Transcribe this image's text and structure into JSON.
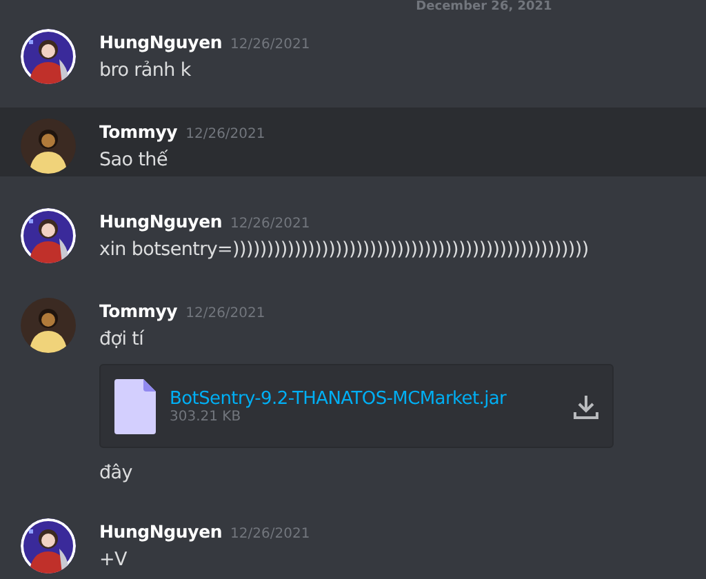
{
  "date_divider": "December 26, 2021",
  "messages": [
    {
      "author": "HungNguyen",
      "timestamp": "12/26/2021",
      "avatar": {
        "kind": "red"
      },
      "highlighted": false,
      "content": [
        {
          "kind": "text",
          "text": "bro rảnh k"
        }
      ]
    },
    {
      "author": "Tommyy",
      "timestamp": "12/26/2021",
      "avatar": {
        "kind": "yellow"
      },
      "highlighted": true,
      "content": [
        {
          "kind": "text",
          "text": "Sao thế"
        }
      ]
    },
    {
      "author": "HungNguyen",
      "timestamp": "12/26/2021",
      "avatar": {
        "kind": "red"
      },
      "highlighted": false,
      "content": [
        {
          "kind": "text",
          "text": "xin botsentry=))))))))))))))))))))))))))))))))))))))))))))))))))))"
        }
      ]
    },
    {
      "author": "Tommyy",
      "timestamp": "12/26/2021",
      "avatar": {
        "kind": "yellow"
      },
      "highlighted": false,
      "content": [
        {
          "kind": "text",
          "text": "đợi tí"
        },
        {
          "kind": "file",
          "name": "BotSentry-9.2-THANATOS-MCMarket.jar",
          "size": "303.21 KB"
        },
        {
          "kind": "text",
          "text": "đây"
        }
      ]
    },
    {
      "author": "HungNguyen",
      "timestamp": "12/26/2021",
      "avatar": {
        "kind": "red"
      },
      "highlighted": false,
      "content": [
        {
          "kind": "text",
          "text": "+V"
        }
      ]
    }
  ]
}
